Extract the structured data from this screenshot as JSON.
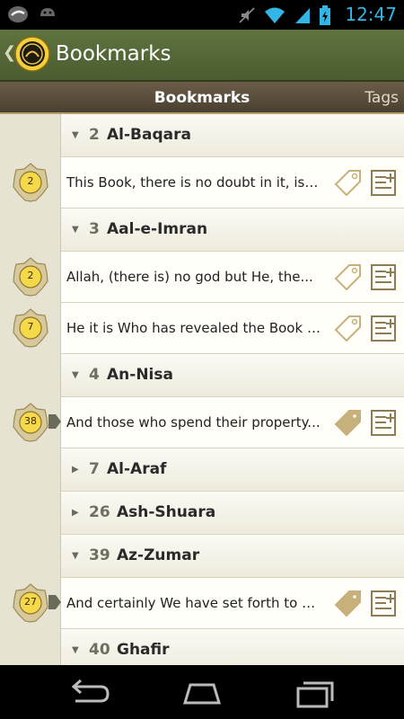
{
  "status": {
    "time": "12:47"
  },
  "action_bar": {
    "title": "Bookmarks"
  },
  "tabs": {
    "active": "Bookmarks",
    "other": "Tags"
  },
  "colors": {
    "accent": "#33b5e5",
    "action_bar": "#5f7340",
    "badge_gold": "#f6d94a"
  },
  "list": [
    {
      "type": "header",
      "number": "2",
      "name": "Al-Baqara"
    },
    {
      "type": "item",
      "verse": "2",
      "text": "This Book, there is no doubt in it, is a...",
      "tagged": false
    },
    {
      "type": "header",
      "number": "3",
      "name": "Aal-e-Imran"
    },
    {
      "type": "item",
      "verse": "2",
      "text": "Allah, (there is) no god but He, the...",
      "tagged": false
    },
    {
      "type": "item",
      "verse": "7",
      "text": "He it is Who has revealed the Book t...",
      "tagged": false
    },
    {
      "type": "header",
      "number": "4",
      "name": "An-Nisa"
    },
    {
      "type": "item",
      "verse": "38",
      "text": "And those who spend their property...",
      "tagged": true
    },
    {
      "type": "header",
      "number": "7",
      "name": "Al-Araf",
      "collapsed": true
    },
    {
      "type": "header",
      "number": "26",
      "name": "Ash-Shuara",
      "collapsed": true
    },
    {
      "type": "header",
      "number": "39",
      "name": "Az-Zumar"
    },
    {
      "type": "item",
      "verse": "27",
      "text": "And certainly We have set forth to m...",
      "tagged": true
    },
    {
      "type": "header",
      "number": "40",
      "name": "Ghafir"
    }
  ]
}
